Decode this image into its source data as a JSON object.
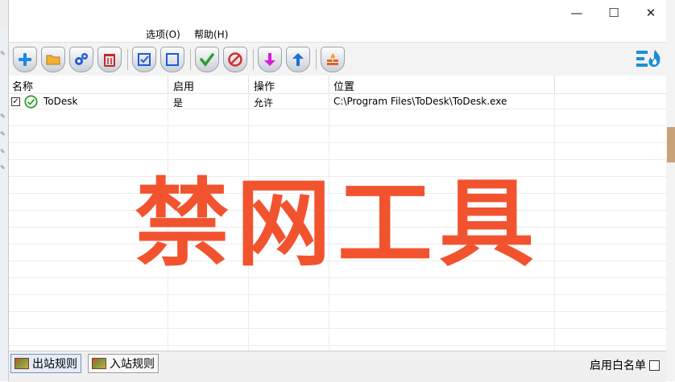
{
  "window": {
    "controls": {
      "minimize": "—",
      "maximize": "☐",
      "close": "✕"
    }
  },
  "menu": {
    "options": "选项(O)",
    "help": "帮助(H)"
  },
  "toolbar": {
    "buttons": [
      {
        "icon": "add-icon",
        "color": "#1e88e5"
      },
      {
        "icon": "folder-icon",
        "color": "#f2b233"
      },
      {
        "icon": "settings-gears-icon",
        "color": "#1e5bd6"
      },
      {
        "icon": "delete-trash-icon",
        "color": "#c62828"
      },
      {
        "icon": "check-all-icon",
        "color": "#1e5bd6"
      },
      {
        "icon": "uncheck-all-icon",
        "color": "#1e5bd6"
      },
      {
        "icon": "allow-check-icon",
        "color": "#2e9e2e"
      },
      {
        "icon": "block-icon",
        "color": "#d32f2f"
      },
      {
        "icon": "move-down-icon",
        "color": "#d81bd8"
      },
      {
        "icon": "move-up-icon",
        "color": "#1e6fd6"
      },
      {
        "icon": "firewall-icon",
        "color": "#e06020"
      }
    ],
    "right_icon": "firewall-flame-icon"
  },
  "table": {
    "columns": [
      "名称",
      "启用",
      "操作",
      "位置"
    ],
    "rows": [
      {
        "checked": true,
        "name": "ToDesk",
        "enabled": "是",
        "action": "允许",
        "path": "C:\\Program Files\\ToDesk\\ToDesk.exe"
      }
    ]
  },
  "overlay_text": "禁网工具",
  "status": {
    "tabs": [
      "出站规则",
      "入站规则"
    ],
    "whitelist_label": "启用白名单"
  },
  "colors": {
    "overlay": "#f2532f",
    "accent_blue": "#1e88e5"
  }
}
